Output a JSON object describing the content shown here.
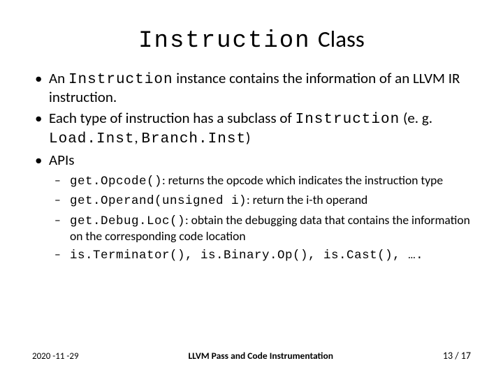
{
  "title": {
    "mono": "Instruction",
    "rest": "Class"
  },
  "bullets": {
    "b1a": "An ",
    "b1_mono": "Instruction",
    "b1b": " instance contains the information of an LLVM IR instruction.",
    "b2a": "Each type of instruction has a subclass of ",
    "b2_mono1": "Instruction",
    "b2b": " (e. g. ",
    "b2_mono2": "Load.Inst",
    "b2c": ", ",
    "b2_mono3": "Branch.Inst",
    "b2d": ")",
    "b3": "APIs"
  },
  "apis": {
    "a1_mono": "get.Opcode()",
    "a1_txt": ": returns the opcode which indicates the instruction type",
    "a2_mono": "get.Operand(unsigned i)",
    "a2_txt": ": return the i-th operand",
    "a3_mono": "get.Debug.Loc()",
    "a3_txt": ": obtain the debugging data that contains the information on the corresponding code location",
    "a4_mono": "is.Terminator(), is.Binary.Op(), is.Cast(), ….",
    "a4_txt": ""
  },
  "footer": {
    "date": "2020 -11 -29",
    "mid": "LLVM Pass and Code Instrumentation",
    "page": "13  / 17"
  }
}
